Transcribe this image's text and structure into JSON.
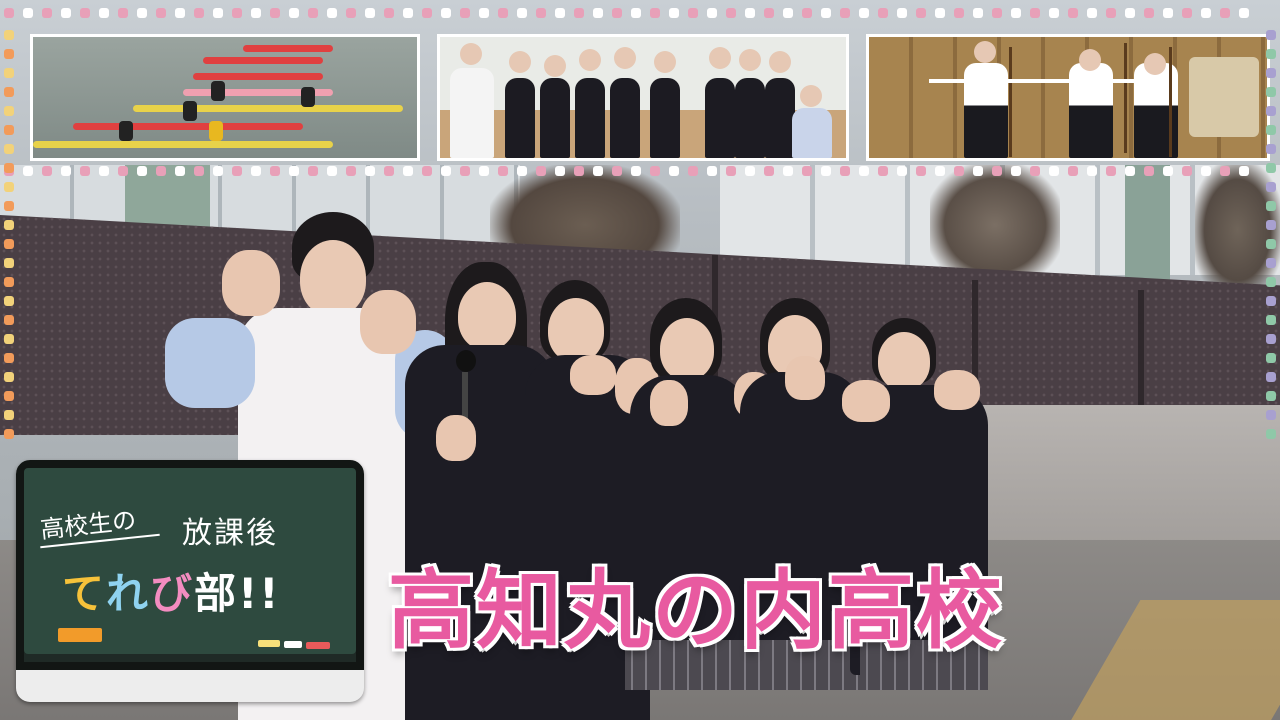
{
  "logo": {
    "line1": "高校生の",
    "line2": "放課後",
    "line3_chars": [
      {
        "ch": "て",
        "color": "#f7c23a"
      },
      {
        "ch": "れ",
        "color": "#8fd3f0"
      },
      {
        "ch": "び",
        "color": "#f38cc0"
      },
      {
        "ch": "部",
        "color": "#ffffff"
      },
      {
        "ch": "!!",
        "color": "#ffffff"
      }
    ]
  },
  "title": "高知丸の内高校",
  "colors": {
    "title_fill": "#e85aa0",
    "title_outline": "#ffffff",
    "board_green": "#2e4a3f",
    "dot_palette": [
      "#f29b5a",
      "#8fc8a8",
      "#e8a0b8",
      "#f2d27a",
      "#a8a0d0",
      "#ffffff"
    ]
  },
  "insets": [
    {
      "subject": "kayak-practice"
    },
    {
      "subject": "choir-practice"
    },
    {
      "subject": "kyudo-archery-practice"
    }
  ]
}
